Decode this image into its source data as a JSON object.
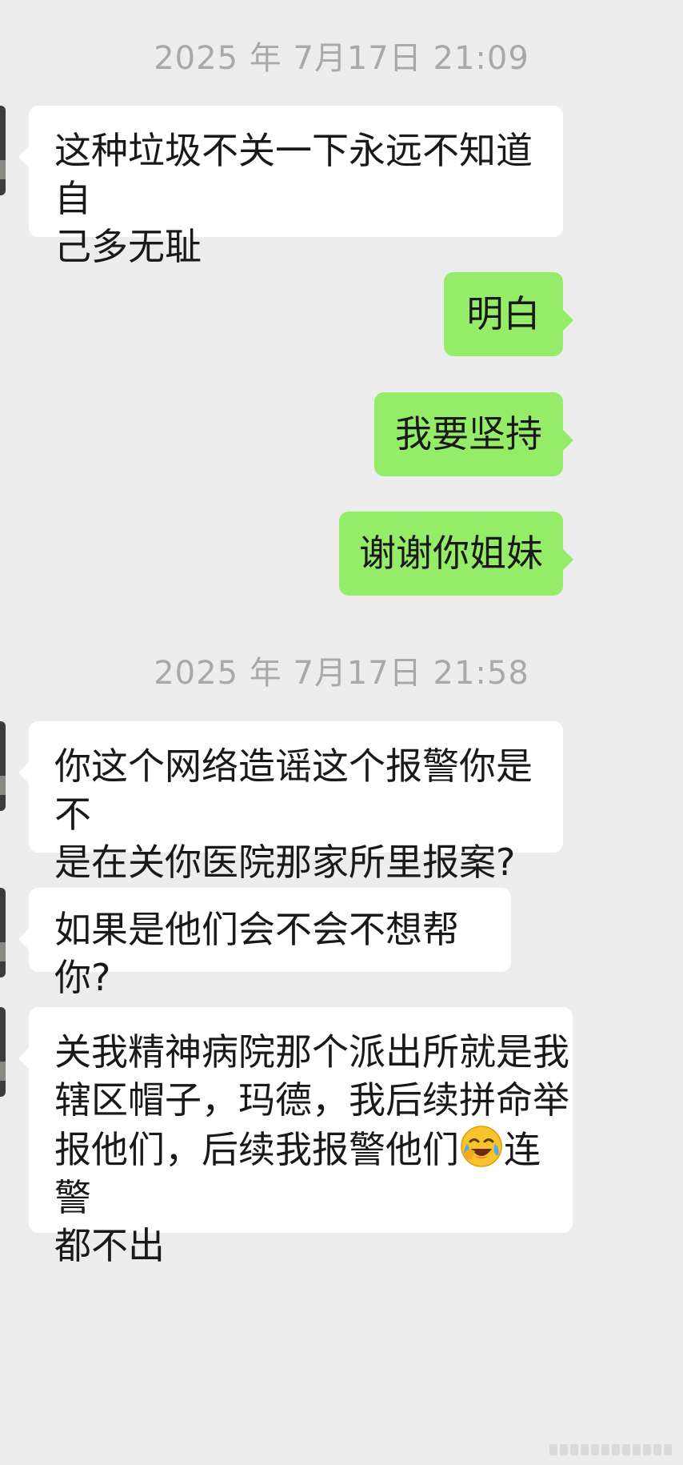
{
  "timestamps": [
    "2025 年 7月17日 21:09",
    "2025 年 7月17日 21:58"
  ],
  "messages": [
    {
      "lines": [
        "这种垃圾不关一下永远不知道自",
        "己多无耻"
      ]
    },
    {
      "lines": [
        "明白"
      ]
    },
    {
      "lines": [
        "我要坚持"
      ]
    },
    {
      "lines": [
        "谢谢你姐妹"
      ]
    },
    {
      "lines": [
        "你这个网络造谣这个报警你是不",
        "是在关你医院那家所里报案?"
      ]
    },
    {
      "lines": [
        "如果是他们会不会不想帮你?"
      ]
    },
    {
      "lines": [
        "关我精神病院那个派出所就是我",
        "辖区帽子，玛德，我后续拼命举",
        "报他们，后续我报警他们",
        "连警",
        "都不出"
      ]
    }
  ],
  "emoji": "crying-laughing-emoji",
  "colors": {
    "background": "#ededed",
    "incoming_bubble": "#ffffff",
    "outgoing_bubble": "#95ec69",
    "timestamp_text": "#a9a9a9"
  }
}
